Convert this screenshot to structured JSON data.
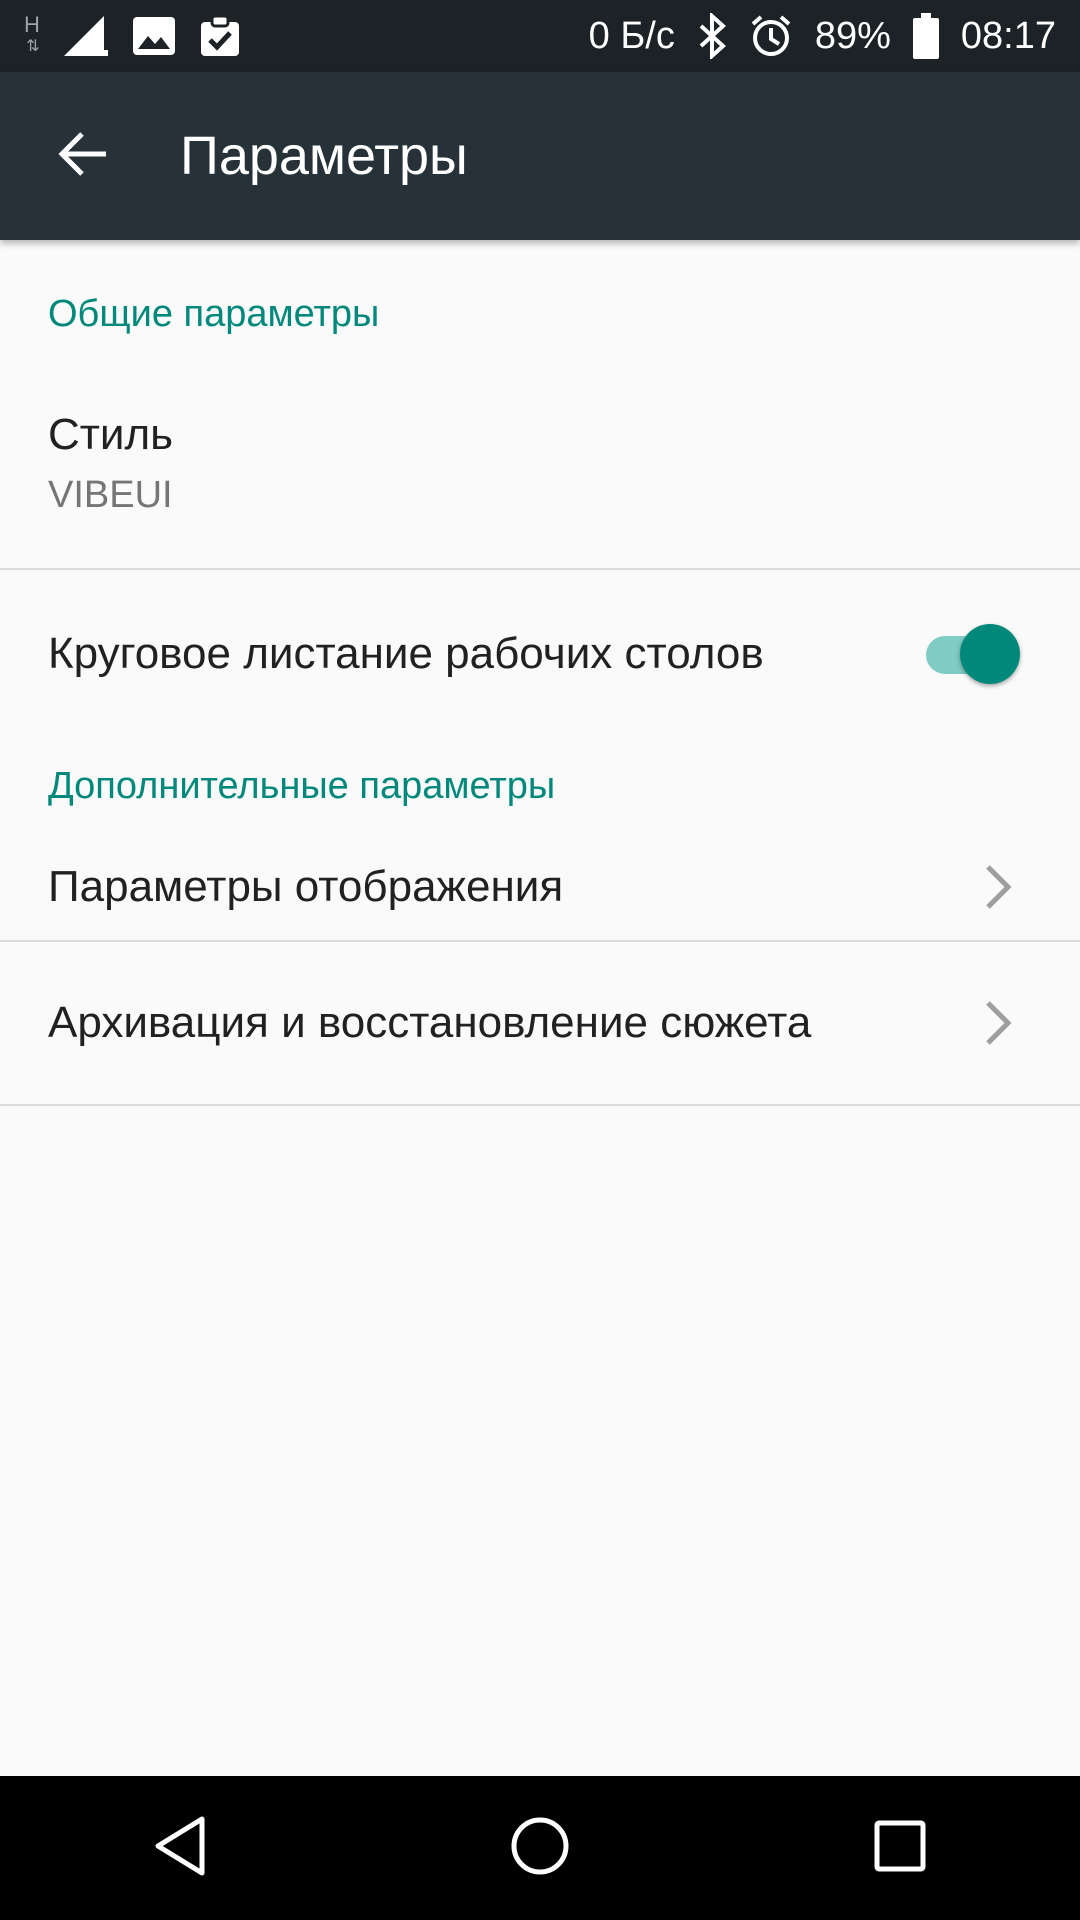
{
  "status_bar": {
    "network_type": "H",
    "data_rate": "0 Б/с",
    "battery_percent": "89%",
    "time": "08:17",
    "icons": [
      "network-h-icon",
      "signal-icon",
      "image-icon",
      "clipboard-check-icon",
      "bluetooth-icon",
      "alarm-icon",
      "battery-icon"
    ]
  },
  "app_bar": {
    "title": "Параметры",
    "back_icon": "arrow-back-icon"
  },
  "sections": {
    "general": {
      "header": "Общие параметры",
      "style": {
        "title": "Стиль",
        "value": "VIBEUI"
      },
      "loop_scroll": {
        "title": "Круговое листание рабочих столов",
        "enabled": true
      }
    },
    "advanced": {
      "header": "Дополнительные параметры",
      "display": {
        "title": "Параметры отображения"
      },
      "backup": {
        "title": "Архивация и восстановление сюжета"
      }
    }
  },
  "colors": {
    "accent": "#00897b",
    "app_bar": "#263238",
    "status_bar": "#1c2226",
    "background": "#fafafa"
  },
  "nav_bar": {
    "buttons": [
      "back-triangle-icon",
      "home-circle-icon",
      "recents-square-icon"
    ]
  }
}
